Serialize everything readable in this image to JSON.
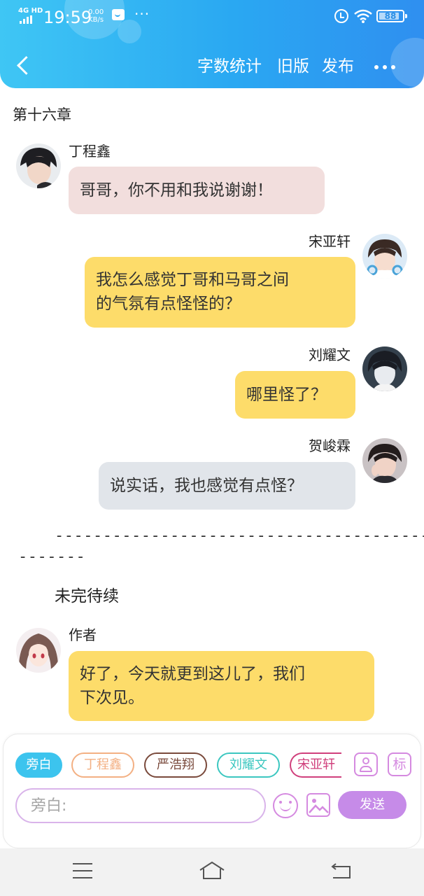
{
  "status_bar": {
    "network": "4G HD",
    "time": "19:59",
    "speed_value": "0.00",
    "speed_unit": "KB/s",
    "battery": "88",
    "battery_level": 0.88
  },
  "toolbar": {
    "word_count": "字数统计",
    "old_version": "旧版",
    "publish": "发布"
  },
  "chapter": "第十六章",
  "messages": [
    {
      "speaker": "丁程鑫",
      "text": "哥哥，你不用和我说谢谢！",
      "side": "left",
      "bubble_color": "#f2dedd"
    },
    {
      "speaker": "宋亚轩",
      "text_line1": "我怎么感觉丁哥和马哥之间",
      "text_line2": "的气氛有点怪怪的？",
      "side": "right",
      "bubble_color": "#fddc6a"
    },
    {
      "speaker": "刘耀文",
      "text": "哪里怪了？",
      "side": "right",
      "bubble_color": "#fddc6a"
    },
    {
      "speaker": "贺峻霖",
      "text": "说实话，我也感觉有点怪？",
      "side": "right",
      "bubble_color": "#e1e5ea"
    }
  ],
  "divider_line1": "----------------------------------------",
  "divider_line2": "-------",
  "to_be_continued": "未完待续",
  "author_message": {
    "speaker": "作者",
    "text_line1": "好了，今天就更到这儿了，我们",
    "text_line2": "下次见。",
    "bubble_color": "#fddc6a"
  },
  "role_chips": [
    {
      "label": "旁白",
      "color": "#3cc4ee",
      "selected": true
    },
    {
      "label": "丁程鑫",
      "color": "#f3b083"
    },
    {
      "label": "严浩翔",
      "color": "#7a4a3c"
    },
    {
      "label": "刘耀文",
      "color": "#3cc7c0"
    },
    {
      "label": "宋亚轩",
      "color": "#d0407c"
    }
  ],
  "mark_label": "标",
  "input": {
    "placeholder": "旁白:"
  },
  "send_label": "发送"
}
